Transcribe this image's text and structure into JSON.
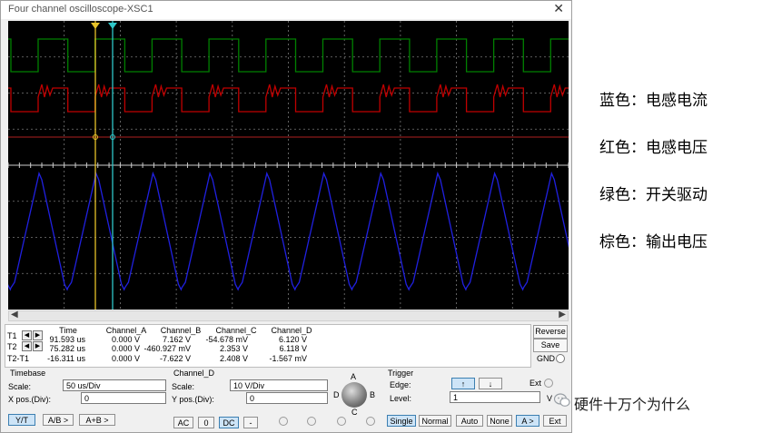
{
  "window": {
    "title": "Four channel oscilloscope-XSC1",
    "close_glyph": "✕"
  },
  "colors": {
    "channel_a": "#c00000",
    "channel_b": "#008000",
    "channel_c": "#2020e0",
    "channel_d": "#8b1a1a",
    "cursor_t1": "#e6c229",
    "cursor_t2": "#2ec7c9",
    "screen_bg": "#000000"
  },
  "measurements": {
    "headers": [
      "Time",
      "Channel_A",
      "Channel_B",
      "Channel_C",
      "Channel_D"
    ],
    "rows": [
      {
        "label": "T1",
        "time": "91.593 us",
        "a": "0.000 V",
        "b": "7.162 V",
        "c": "-54.678 mV",
        "d": "6.120 V"
      },
      {
        "label": "T2",
        "time": "75.282 us",
        "a": "0.000 V",
        "b": "-460.927 mV",
        "c": "2.353 V",
        "d": "6.118 V"
      },
      {
        "label": "T2-T1",
        "time": "-16.311 us",
        "a": "0.000 V",
        "b": "-7.622 V",
        "c": "2.408 V",
        "d": "-1.567 mV"
      }
    ]
  },
  "side_buttons": {
    "reverse": "Reverse",
    "save": "Save",
    "gnd": "GND"
  },
  "timebase": {
    "title": "Timebase",
    "scale_label": "Scale:",
    "scale_value": "50 us/Div",
    "xpos_label": "X pos.(Div):",
    "xpos_value": "0",
    "modes": [
      "Y/T",
      "A/B >",
      "A+B >"
    ],
    "active_mode": "Y/T"
  },
  "channel": {
    "title": "Channel_D",
    "scale_label": "Scale:",
    "scale_value": "10  V/Div",
    "ypos_label": "Y pos.(Div):",
    "ypos_value": "0",
    "couplings": [
      "AC",
      "0",
      "DC",
      "-"
    ],
    "active_coupling": "DC",
    "knob_labels": {
      "a": "A",
      "b": "B",
      "c": "C",
      "d": "D"
    }
  },
  "trigger": {
    "title": "Trigger",
    "edge_label": "Edge:",
    "edge_rise_glyph": "↑",
    "edge_fall_glyph": "↓",
    "ext_label": "Ext",
    "level_label": "Level:",
    "level_value": "1",
    "level_unit": "V",
    "modes": [
      "Single",
      "Normal",
      "Auto",
      "None"
    ],
    "active_mode": "Single",
    "source_buttons": [
      "A >",
      "Ext"
    ],
    "active_source": "A >"
  },
  "legend": [
    {
      "text": "蓝色：电感电流"
    },
    {
      "text": "红色：电感电压"
    },
    {
      "text": "绿色：开关驱动"
    },
    {
      "text": "棕色：输出电压"
    }
  ],
  "watermark": {
    "text": "硬件十万个为什么",
    "icon": "wechat-icon"
  }
}
